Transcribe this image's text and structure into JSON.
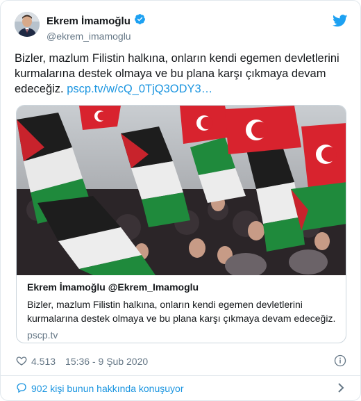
{
  "author": {
    "name": "Ekrem İmamoğlu",
    "handle": "@ekrem_imamoglu",
    "verified_icon": "verified-badge-icon",
    "brand_icon": "twitter-bird-icon"
  },
  "tweet": {
    "text": "Bizler, mazlum Filistin halkına, onların kendi egemen devletlerini kurmalarına destek olmaya ve bu plana karşı çıkmaya devam edeceğiz.",
    "link": "pscp.tv/w/cQ_0TjQ3ODY3…"
  },
  "card": {
    "title": "Ekrem İmamoğlu @Ekrem_Imamoglu",
    "description": "Bizler, mazlum Filistin halkına, onların kendi egemen devletlerini kurmalarına destek olmaya ve bu plana karşı çıkmaya devam edeceğiz.",
    "domain": "pscp.tv"
  },
  "meta": {
    "likes": "4.513",
    "timestamp": "15:36 - 9 Şub 2020"
  },
  "footer": {
    "replies_text": "902 kişi bunun hakkında konuşuyor"
  },
  "colors": {
    "brand": "#1da1f2",
    "link": "#1b95e0",
    "text": "#14171a",
    "muted": "#657786",
    "border": "#e1e8ed"
  }
}
